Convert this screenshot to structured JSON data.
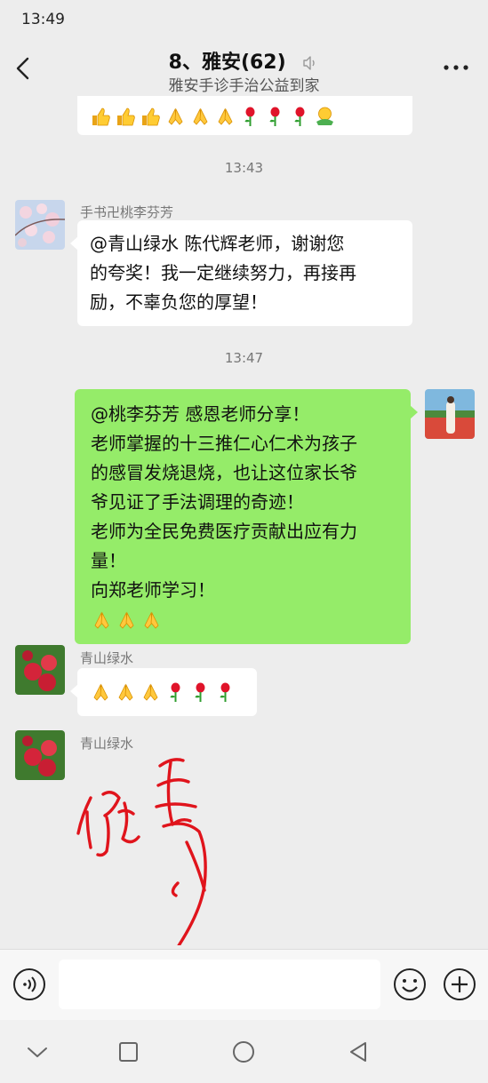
{
  "status_bar": {
    "time": "13:49"
  },
  "header": {
    "title": "8、雅安(62)",
    "subtitle": "雅安手诊手治公益到家"
  },
  "messages": {
    "ts1": "13:43",
    "msg1_sender": "手书卍桃李芬芳",
    "msg1_line1": "@青山绿水  陈代辉老师，谢谢您",
    "msg1_line2": "的夸奖！我一定继续努力，再接再",
    "msg1_line3": "励，不辜负您的厚望！",
    "ts2": "13:47",
    "msg2_line1": "@桃李芬芳  感恩老师分享！",
    "msg2_line2": "老师掌握的十三推仁心仁术为孩子",
    "msg2_line3": "的感冒发烧退烧，也让这位家长爷",
    "msg2_line4": "爷见证了手法调理的奇迹！",
    "msg2_line5": "老师为全民免费医疗贡献出应有力",
    "msg2_line6": "量！",
    "msg2_line7": "向郑老师学习！",
    "msg3_sender": "青山绿水",
    "msg4_sender": "青山绿水"
  },
  "icons": {
    "back": "chevron-left-icon",
    "mute": "mute-icon",
    "more": "more-icon",
    "voice": "voice-icon",
    "emoji": "emoji-icon",
    "plus": "plus-icon",
    "thumbs": "thumbs-up-emoji",
    "pray": "pray-emoji",
    "rose": "rose-emoji",
    "hug": "hug-emoji"
  },
  "colors": {
    "chat_bg": "#ededed",
    "my_bubble": "#95ec69",
    "other_bubble": "#ffffff",
    "ink_red": "#e0141c"
  }
}
